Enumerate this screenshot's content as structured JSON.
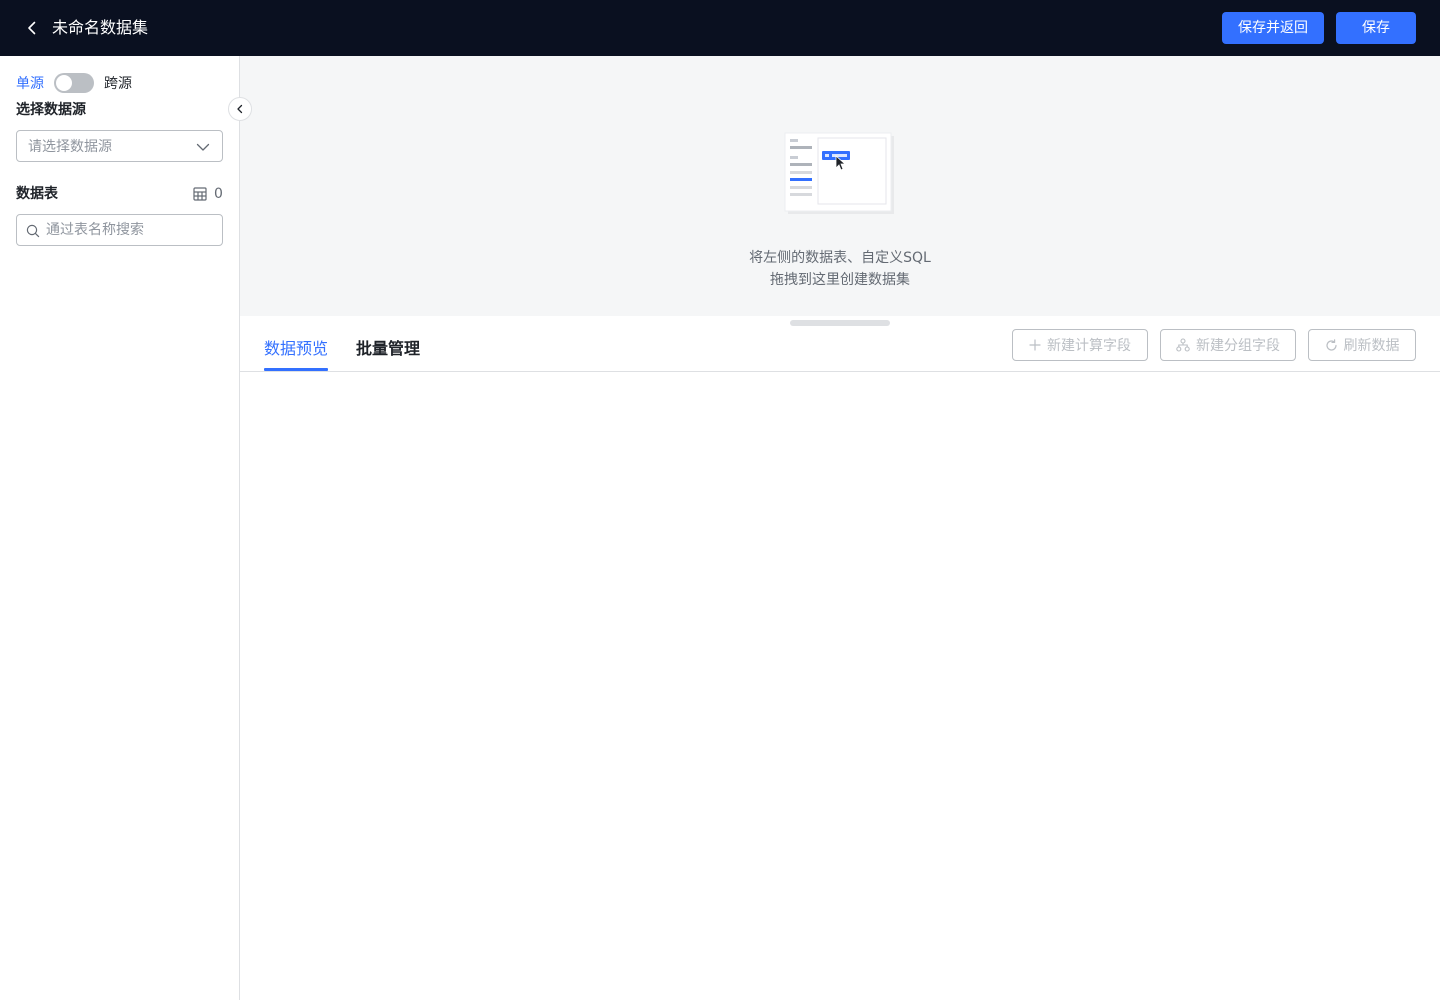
{
  "header": {
    "back_icon": "chevron-left-icon",
    "title": "未命名数据集",
    "save_return_label": "保存并返回",
    "save_label": "保存"
  },
  "sidebar": {
    "mode_single": "单源",
    "mode_cross": "跨源",
    "mode_cross_enabled": false,
    "datasource_label": "选择数据源",
    "datasource_placeholder": "请选择数据源",
    "tables_label": "数据表",
    "tables_count": "0",
    "search_placeholder": "通过表名称搜索"
  },
  "canvas": {
    "hint_line1": "将左侧的数据表、自定义SQL",
    "hint_line2": "拖拽到这里创建数据集"
  },
  "tabs": {
    "preview_label": "数据预览",
    "batch_label": "批量管理",
    "active": "preview"
  },
  "toolbar": {
    "calc_field_label": "新建计算字段",
    "group_field_label": "新建分组字段",
    "refresh_label": "刷新数据"
  },
  "colors": {
    "primary": "#3370ff",
    "header_bg": "#0a1020",
    "disabled_text": "#bbbfc4"
  }
}
